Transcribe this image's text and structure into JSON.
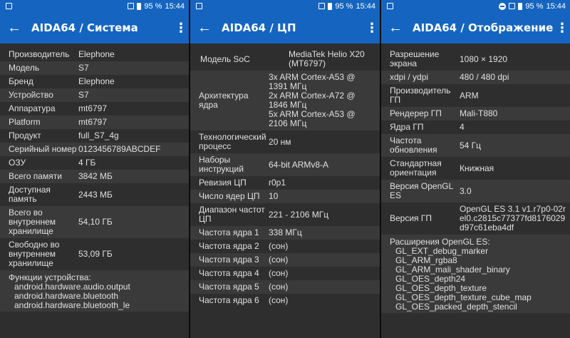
{
  "status": {
    "battery": "95 %",
    "time": "15:44"
  },
  "screens": [
    {
      "title": "AIDA64  /  Система",
      "rows": [
        {
          "k": "Производитель",
          "v": "Elephone"
        },
        {
          "k": "Модель",
          "v": "S7"
        },
        {
          "k": "Бренд",
          "v": "Elephone"
        },
        {
          "k": "Устройство",
          "v": "S7"
        },
        {
          "k": "Аппаратура",
          "v": "mt6797"
        },
        {
          "k": "Platform",
          "v": "mt6797"
        },
        {
          "k": "Продукт",
          "v": "full_S7_4g"
        },
        {
          "k": "Серийный номер",
          "v": "0123456789ABCDEF"
        },
        {
          "k": "ОЗУ",
          "v": "4 ГБ"
        },
        {
          "k": "Всего памяти",
          "v": "3842 МБ"
        },
        {
          "k": "Доступная память",
          "v": "2443 МБ"
        },
        {
          "k": "Всего во внутреннем хранилище",
          "v": "54,10 ГБ"
        },
        {
          "k": "Свободно во внутреннем хранилище",
          "v": "53,09 ГБ"
        }
      ],
      "block_title": "Функции устройства:",
      "block_items": [
        "android.hardware.audio.output",
        "android.hardware.bluetooth",
        "android.hardware.bluetooth_le"
      ]
    },
    {
      "title": "AIDA64  /  ЦП",
      "rows": [
        {
          "k": "Модель SoC",
          "v": "MediaTek Helio X20 (MT6797)"
        },
        {
          "k": "Архитектура ядра",
          "v": "3x ARM Cortex-A53 @ 1391 МГц\n2x ARM Cortex-A72 @ 1846 МГц\n5x ARM Cortex-A53 @ 2106 МГц"
        },
        {
          "k": "Технологический процесс",
          "v": "20 нм"
        },
        {
          "k": "Наборы инструкций",
          "v": "64-bit ARMv8-A"
        },
        {
          "k": "Ревизия ЦП",
          "v": "r0p1"
        },
        {
          "k": "Число ядер ЦП",
          "v": "10"
        },
        {
          "k": "Диапазон частот ЦП",
          "v": "221 - 2106 МГц"
        },
        {
          "k": "Частота ядра 1",
          "v": "338 МГц"
        },
        {
          "k": "Частота ядра 2",
          "v": "(сон)"
        },
        {
          "k": "Частота ядра 3",
          "v": "(сон)"
        },
        {
          "k": "Частота ядра 4",
          "v": "(сон)"
        },
        {
          "k": "Частота ядра 5",
          "v": "(сон)"
        },
        {
          "k": "Частота ядра 6",
          "v": "(сон)"
        }
      ]
    },
    {
      "title": "AIDA64  /  Отображение",
      "rows": [
        {
          "k": "Разрешение экрана",
          "v": "1080 × 1920"
        },
        {
          "k": "xdpi / ydpi",
          "v": "480 / 480 dpi"
        },
        {
          "k": "Производитель ГП",
          "v": "ARM"
        },
        {
          "k": "Рендерер ГП",
          "v": "Mali-T880"
        },
        {
          "k": "Ядра ГП",
          "v": "4"
        },
        {
          "k": "Частота обновления",
          "v": "54 Гц"
        },
        {
          "k": "Стандартная ориентация",
          "v": "Книжная"
        },
        {
          "k": "Версия OpenGL ES",
          "v": "3.0"
        },
        {
          "k": "Версия ГП",
          "v": "OpenGL ES 3.1 v1.r7p0-02rel0.c2815c77377fd8176029d97c61eba4df"
        }
      ],
      "block_title": "Расширения OpenGL ES:",
      "block_items": [
        "GL_EXT_debug_marker",
        "GL_ARM_rgba8",
        "GL_ARM_mali_shader_binary",
        "GL_OES_depth24",
        "GL_OES_depth_texture",
        "GL_OES_depth_texture_cube_map",
        "GL_OES_packed_depth_stencil"
      ]
    }
  ]
}
